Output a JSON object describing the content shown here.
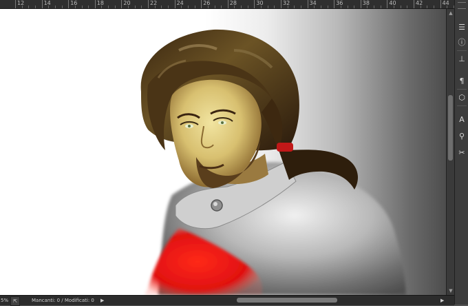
{
  "ruler": {
    "labels": [
      "12",
      "14",
      "16",
      "18",
      "20",
      "22",
      "24",
      "26",
      "28",
      "30",
      "32",
      "34",
      "36",
      "38",
      "40",
      "42",
      "44"
    ]
  },
  "status": {
    "zoom": "5%",
    "text": "Mancanti: 0 / Modificati: 0"
  },
  "dock": {
    "items": [
      {
        "name": "layers-icon",
        "glyph": "☰"
      },
      {
        "name": "info-icon",
        "glyph": "ⓘ"
      },
      {
        "name": "align-icon",
        "glyph": "⊥"
      },
      {
        "name": "paragraph-icon",
        "glyph": "¶"
      },
      {
        "name": "cube-icon",
        "glyph": "⬡"
      },
      {
        "name": "character-icon",
        "glyph": "A"
      },
      {
        "name": "brush-icon",
        "glyph": "⚲"
      },
      {
        "name": "tools-icon",
        "glyph": "✂"
      }
    ]
  }
}
